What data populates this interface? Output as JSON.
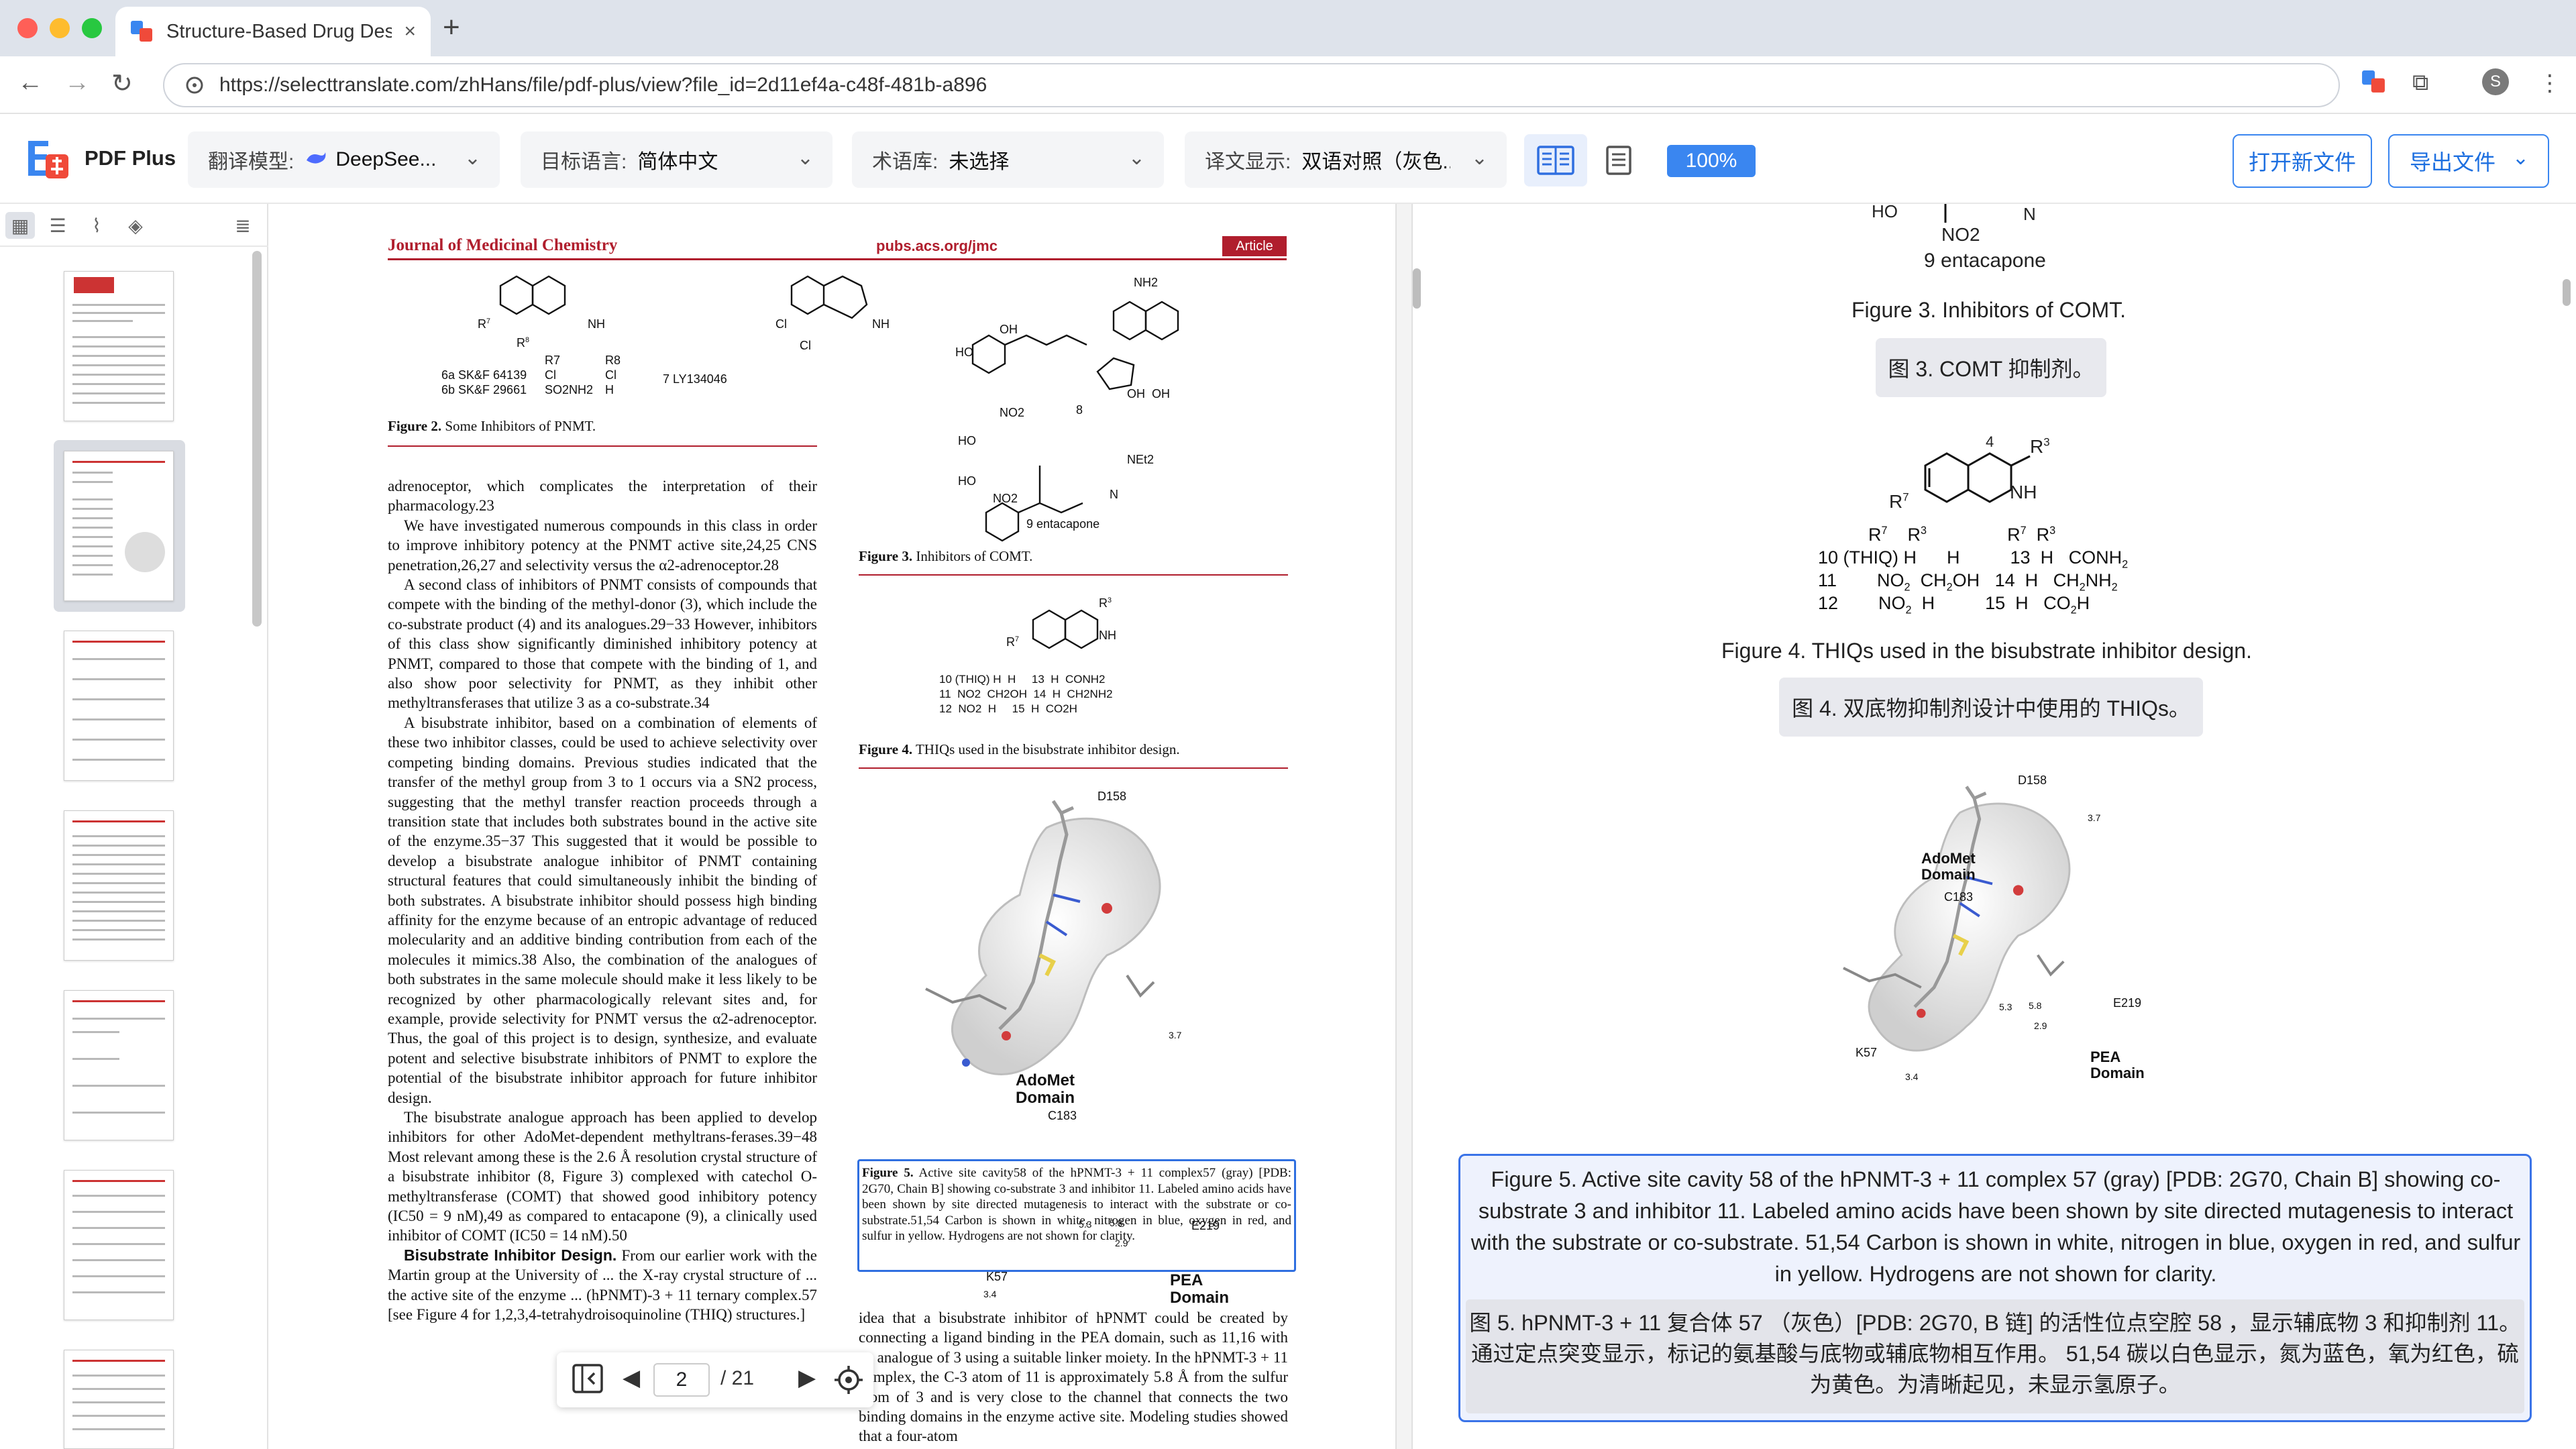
{
  "browser": {
    "tab_title": "Structure-Based Drug Design",
    "tab_close": "×",
    "new_tab": "+",
    "url": "https://selecttranslate.com/zhHans/file/pdf-plus/view?file_id=2d11ef4a-c48f-481b-a896",
    "profile_initial": "S"
  },
  "app": {
    "name": "PDF Plus",
    "model_label": "翻译模型:",
    "model_value": "DeepSee...",
    "target_label": "目标语言:",
    "target_value": "简体中文",
    "glossary_label": "术语库:",
    "glossary_value": "未选择",
    "display_label": "译文显示:",
    "display_value": "双语对照（灰色...",
    "zoom": "100%",
    "open_new": "打开新文件",
    "export": "导出文件"
  },
  "pager": {
    "current": "2",
    "total": "/ 21"
  },
  "pdf": {
    "journal": "Journal of Medicinal Chemistry",
    "journal_url": "pubs.acs.org/jmc",
    "article_tag": "Article",
    "fig2_caption_label": "Figure 2.",
    "fig2_caption": " Some Inhibitors of PNMT.",
    "fig3_caption_label": "Figure 3.",
    "fig3_caption": " Inhibitors of COMT.",
    "fig4_caption_label": "Figure 4.",
    "fig4_caption": " THIQs used in the bisubstrate inhibitor design.",
    "fig5_caption_label": "Figure 5.",
    "fig5_caption": "Active site cavity58 of the hPNMT-3 + 11 complex57 (gray) [PDB: 2G70, Chain B] showing co-substrate 3 and inhibitor 11. Labeled amino acids have been shown by site directed mutagenesis to interact with the substrate or co-substrate.51,54 Carbon is shown in white, nitrogen in blue, oxygen in red, and sulfur in yellow. Hydrogens are not shown for clarity.",
    "left_col": [
      "adrenoceptor, which complicates the interpretation of their pharmacology.23",
      "We have investigated numerous compounds in this class in order to improve inhibitory potency at the PNMT active site,24,25 CNS penetration,26,27 and selectivity versus the α2-adrenoceptor.28",
      "A second class of inhibitors of PNMT consists of compounds that compete with the binding of the methyl-donor (3), which include the co-substrate product (4) and its analogues.29−33 However, inhibitors of this class show significantly diminished inhibitory potency at PNMT, compared to those that compete with the binding of 1, and also show poor selectivity for PNMT, as they inhibit other methyltransferases that utilize 3 as a co-substrate.34",
      "A bisubstrate inhibitor, based on a combination of elements of these two inhibitor classes, could be used to achieve selectivity over competing binding domains. Previous studies indicated that the transfer of the methyl group from 3 to 1 occurs via a SN2 process, suggesting that the methyl transfer reaction proceeds through a transition state that includes both substrates bound in the active site of the enzyme.35−37 This suggested that it would be possible to develop a bisubstrate analogue inhibitor of PNMT containing structural features that could simultaneously inhibit the binding of both substrates. A bisubstrate inhibitor should possess high binding affinity for the enzyme because of an entropic advantage of reduced molecularity and an additive binding contribution from each of the molecules it mimics.38 Also, the combination of the analogues of both substrates in the same molecule should make it less likely to be recognized by other pharmacologically relevant sites and, for example, provide selectivity for PNMT versus the α2-adrenoceptor. Thus, the goal of this project is to design, synthesize, and evaluate potent and selective bisubstrate inhibitors of PNMT to explore the potential of the bisubstrate inhibitor approach for future inhibitor design.",
      "The bisubstrate analogue approach has been applied to develop inhibitors for other AdoMet-dependent methyltrans-ferases.39−48 Most relevant among these is the 2.6 Å resolution crystal structure of a bisubstrate inhibitor (8, Figure 3) complexed with catechol O-methyltransferase (COMT) that showed good inhibitory potency (IC50 = 9 nM),49 as compared to entacapone (9), a clinically used inhibitor of COMT (IC50 = 14 nM).50"
    ],
    "left_heading": "Bisubstrate Inhibitor Design.",
    "left_tail": "From our earlier work with the Martin group at the University of ... the X-ray crystal structure of ... the active site of the enzyme ... (hPNMT)-3 + 11 ternary complex.57 [see Figure 4 for 1,2,3,4-tetrahydroisoquinoline (THIQ) structures.]",
    "right_tail": "idea that a bisubstrate inhibitor of hPNMT could be created by connecting a ligand binding in the PEA domain, such as 11,16 with an analogue of 3 using a suitable linker moiety. In the hPNMT-3 + 11 complex, the C-3 atom of 11 is approximately 5.8 Å from the sulfur atom of 3 and is very close to the channel that connects the two binding domains in the enzyme active site. Modeling studies showed that a four-atom",
    "fig2_labels": {
      "a": "6a SK&F 64139",
      "b": "6b SK&F 29661",
      "r7": "R7",
      "r8": "R8",
      "cl": "Cl",
      "so": "SO2NH2",
      "h": "H",
      "ly": "7 LY134046"
    },
    "fig3_labels": {
      "c8": "8",
      "c9": "9 entacapone",
      "no2": "NO2",
      "net2": "NEt2",
      "nh2": "NH2"
    },
    "fig4_table": "10 (THIQ) H  H     13  H  CONH2\n11  NO2  CH2OH  14  H  CH2NH2\n12  NO2  H     15  H  CO2H",
    "fig5_labels": {
      "d158": "D158",
      "adomet": "AdoMet\nDomain",
      "c183": "C183",
      "e219": "E219",
      "k57": "K57",
      "pea": "PEA\nDomain",
      "d1": "3.7",
      "d2": "5.3",
      "d3": "5.8",
      "d4": "2.9",
      "d5": "3.4"
    }
  },
  "translation": {
    "top_no2": "NO2",
    "top_c9": "9 entacapone",
    "fig3_en": "Figure 3. Inhibitors of COMT.",
    "fig3_zh": "图 3. COMT 抑制剂。",
    "fig4_en": "Figure 4. THIQs used in the bisubstrate inhibitor design.",
    "fig4_zh": "图 4. 双底物抑制剂设计中使用的 THIQs。",
    "fig5_en": "Figure 5. Active site cavity 58 of the hPNMT-3 + 11 complex 57 (gray) [PDB: 2G70, Chain B] showing co-substrate 3 and inhibitor 11. Labeled amino acids have been shown by site directed mutagenesis to interact with the substrate or co-substrate. 51,54 Carbon is shown in white, nitrogen in blue, oxygen in red, and sulfur in yellow. Hydrogens are not shown for clarity.",
    "fig5_zh": "图 5. hPNMT-3 + 11 复合体 57 （灰色）[PDB: 2G70, B 链] 的活性位点空腔 58 ，显示辅底物 3 和抑制剂 11。通过定点突变显示，标记的氨基酸与底物或辅底物相互作用。 51,54 碳以白色显示，氮为蓝色，氧为红色，硫为黄色。为清晰起见，未显示氢原子。"
  }
}
